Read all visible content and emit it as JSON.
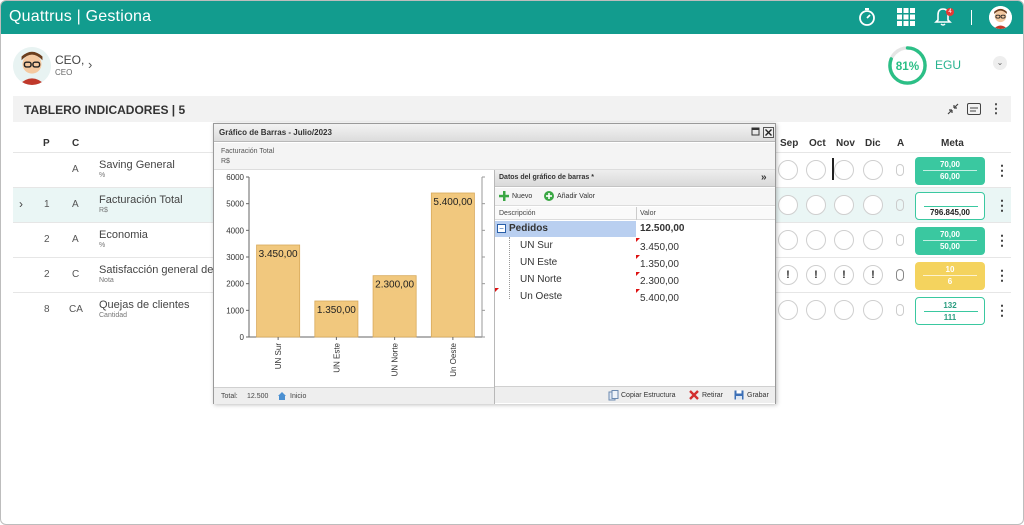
{
  "app": {
    "brand": "Quattrus | Gestiona",
    "icons": [
      "stopwatch-icon",
      "apps-grid-icon",
      "bell-icon"
    ],
    "notification_count": "4"
  },
  "user": {
    "name": "CEO,",
    "role": "CEO"
  },
  "score": {
    "percent": "81%",
    "value": 81,
    "label": "EGU",
    "color": "#2bbf86"
  },
  "dashboard": {
    "title": "TABLERO INDICADORES | 5"
  },
  "table": {
    "left_headers": [
      "P",
      "C"
    ],
    "month_headers": [
      "Sep",
      "Oct",
      "Nov",
      "Dic"
    ],
    "a_header": "A",
    "meta_header": "Meta",
    "rows": [
      {
        "p": "",
        "c": "A",
        "name": "Saving General",
        "unit": "%",
        "meta_top": "70,00",
        "meta_bottom": "60,00",
        "meta_style": "green",
        "circles": [
          "",
          "",
          "",
          ""
        ]
      },
      {
        "p": "1",
        "c": "A",
        "name": "Facturación Total",
        "unit": "R$",
        "meta_top": "",
        "meta_bottom": "796.845,00",
        "meta_style": "white",
        "circles": [
          "",
          "",
          "",
          ""
        ]
      },
      {
        "p": "2",
        "c": "A",
        "name": "Economia",
        "unit": "%",
        "meta_top": "70,00",
        "meta_bottom": "50,00",
        "meta_style": "green",
        "circles": [
          "",
          "",
          "",
          ""
        ]
      },
      {
        "p": "2",
        "c": "C",
        "name": "Satisfacción general de cl",
        "unit": "Nota",
        "meta_top": "10",
        "meta_bottom": "6",
        "meta_style": "yellow",
        "circles": [
          "!",
          "!",
          "!",
          "!"
        ]
      },
      {
        "p": "8",
        "c": "CA",
        "name": "Quejas de clientes",
        "unit": "Cantidad",
        "meta_top": "132",
        "meta_bottom": "111",
        "meta_style": "white",
        "circles": [
          "",
          "",
          "",
          ""
        ]
      }
    ]
  },
  "popup": {
    "title": "Gráfico de Barras - Julio/2023",
    "chart_title": "Facturación Total",
    "chart_unit": "R$",
    "footer_total_label": "Total:",
    "footer_total_value": "12.500",
    "footer_home": "Inicio",
    "data_panel": {
      "title": "Datos del gráfico de barras *",
      "btn_new": "Nuevo",
      "btn_add": "Añadir Valor",
      "col_desc": "Descripción",
      "col_value": "Valor",
      "group": {
        "label": "Pedidos",
        "value": "12.500,00"
      },
      "items": [
        {
          "label": "UN Sur",
          "value": "3.450,00"
        },
        {
          "label": "UN Este",
          "value": "1.350,00"
        },
        {
          "label": "UN Norte",
          "value": "2.300,00"
        },
        {
          "label": "Un Oeste",
          "value": "5.400,00"
        }
      ],
      "btn_copy": "Copiar Estructura",
      "btn_remove": "Retirar",
      "btn_save": "Grabar"
    }
  },
  "chart_data": {
    "type": "bar",
    "title": "",
    "categories": [
      "UN Sur",
      "UN Este",
      "UN Norte",
      "Un Oeste"
    ],
    "values": [
      3450,
      1350,
      2300,
      5400
    ],
    "value_labels": [
      "3.450,00",
      "1.350,00",
      "2.300,00",
      "5.400,00"
    ],
    "ylim": [
      0,
      6000
    ],
    "yticks": [
      0,
      1000,
      2000,
      3000,
      4000,
      5000,
      6000
    ],
    "bar_color": "#f1c87e",
    "grid": false
  }
}
